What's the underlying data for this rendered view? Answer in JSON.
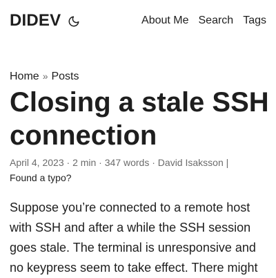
{
  "header": {
    "logo": "DIDEV",
    "theme_toggle_icon": "moon-icon",
    "nav": [
      {
        "label": "About Me"
      },
      {
        "label": "Search"
      },
      {
        "label": "Tags"
      }
    ]
  },
  "breadcrumb": {
    "home": "Home",
    "separator": "»",
    "posts": "Posts"
  },
  "post": {
    "title": "Closing a stale SSH connection",
    "meta": {
      "date": "April 4, 2023",
      "dot1": " · ",
      "reading_time": "2 min",
      "dot2": " · ",
      "word_count": "347 words",
      "dot3": " · ",
      "author": "David Isaksson",
      "pipe": " |",
      "typo_link": "Found a typo?"
    },
    "content": "Suppose you’re connected to a remote host with SSH and after a while the SSH session goes stale. The terminal is unresponsive and no keypress seem to take effect. There might"
  },
  "colors": {
    "text": "#1e1e1e",
    "secondary": "#6b6b6b",
    "background": "#ffffff"
  }
}
